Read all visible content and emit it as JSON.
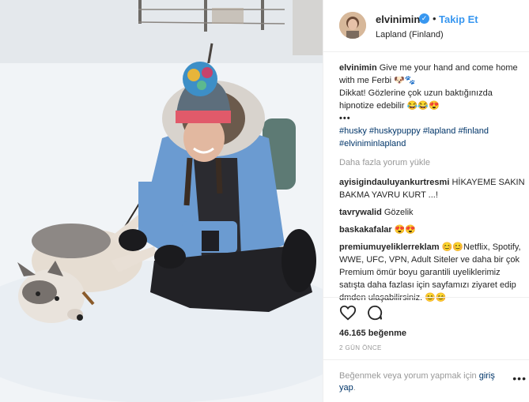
{
  "post": {
    "username": "elvinimin",
    "verified_icon": "verified-badge-icon",
    "separator": "•",
    "follow_label": "Takip Et",
    "location": "Lapland (Finland)"
  },
  "caption": {
    "username": "elvinimin",
    "line1": "Give me your hand and come home with me Ferbi 🐶🐾",
    "line2": "Dikkat! Gözlerine çok uzun baktığınızda hipnotize edebilir 😂😂😍",
    "more": "•••",
    "hashtags": [
      "#husky",
      "#huskypuppy",
      "#lapland",
      "#finland",
      "#elviniminlapland"
    ]
  },
  "load_more": "Daha fazla yorum yükle",
  "comments": [
    {
      "user": "ayisigindauluyankurtresmi",
      "text": "HİKAYEME SAKIN BAKMA YAVRU KURT ...!"
    },
    {
      "user": "tavrywalid",
      "text": "Gözelik"
    },
    {
      "user": "baskakafalar",
      "text": "😍😍"
    },
    {
      "user": "premiumuyeliklerreklam",
      "text": "😊😊Netflix, Spotify, WWE, UFC, VPN, Adult Siteler ve daha bir çok Premium ömür boyu garantili uyeliklerimiz satışta daha fazlası için sayfamızı ziyaret edip dmden ulaşabilirsiniz. 😊😊"
    }
  ],
  "actions": {
    "like_icon": "heart-icon",
    "comment_icon": "comment-bubble-icon"
  },
  "likes": "46.165 beğenme",
  "timestamp": "2 GÜN ÖNCE",
  "footer": {
    "prompt": "Beğenmek veya yorum yapmak için",
    "login_label": "giriş yap",
    "period": ".",
    "options": "•••"
  },
  "colors": {
    "accent": "#3897f0",
    "link": "#003569",
    "muted": "#999999",
    "jacket": "#6b9bd1"
  }
}
